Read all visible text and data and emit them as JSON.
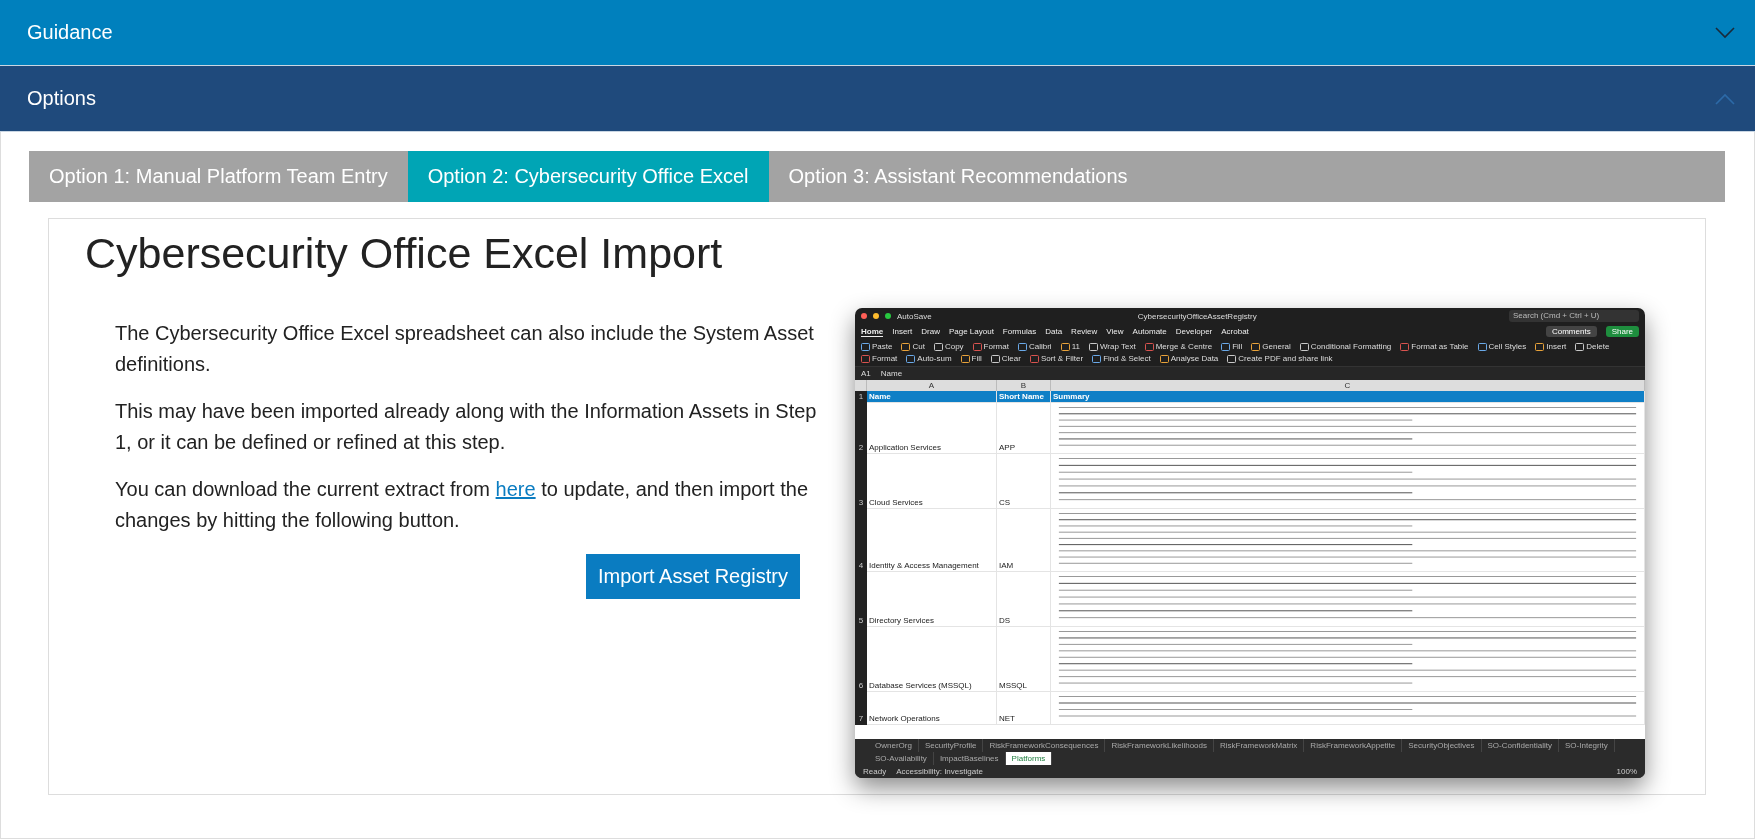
{
  "sections": [
    {
      "title": "Guidance",
      "expanded": false
    },
    {
      "title": "Options",
      "expanded": true
    }
  ],
  "tabs": [
    {
      "label": "Option 1: Manual Platform Team Entry",
      "selected": false
    },
    {
      "label": "Option 2: Cybersecurity Office Excel",
      "selected": true
    },
    {
      "label": "Option 3: Assistant Recommendations",
      "selected": false
    }
  ],
  "content": {
    "heading": "Cybersecurity Office Excel Import",
    "paragraphs": [
      {
        "text": "The Cybersecurity Office Excel spreadsheet can also include the System Asset definitions."
      },
      {
        "text": "This may have been imported already along with the Information Assets in Step 1, or it can be defined or refined at this step."
      },
      {
        "text": "You can download the current extract from ",
        "link": "here",
        "after": " to update, and then import the changes by hitting the following button."
      }
    ],
    "button": "Import Asset Registry"
  },
  "excel": {
    "autosave": "AutoSave",
    "title": "CybersecurityOfficeAssetRegistry",
    "search": {
      "placeholder": "Search (Cmd + Ctrl + U)"
    },
    "ribbon_tabs": [
      {
        "label": "Home",
        "selected": true
      },
      {
        "label": "Insert",
        "selected": false
      },
      {
        "label": "Draw",
        "selected": false
      },
      {
        "label": "Page Layout",
        "selected": false
      },
      {
        "label": "Formulas",
        "selected": false
      },
      {
        "label": "Data",
        "selected": false
      },
      {
        "label": "Review",
        "selected": false
      },
      {
        "label": "View",
        "selected": false
      },
      {
        "label": "Automate",
        "selected": false
      },
      {
        "label": "Developer",
        "selected": false
      },
      {
        "label": "Acrobat",
        "selected": false
      }
    ],
    "comments": "Comments",
    "share": "Share",
    "ribbon_buttons": [
      "Paste",
      "Cut",
      "Copy",
      "Format",
      "Calibri",
      "11",
      "Wrap Text",
      "Merge & Centre",
      "Fill",
      "General",
      "Conditional Formatting",
      "Format as Table",
      "Cell Styles",
      "Insert",
      "Delete",
      "Format",
      "Auto-sum",
      "Fill",
      "Clear",
      "Sort & Filter",
      "Find & Select",
      "Analyse Data",
      "Create PDF and share link"
    ],
    "name_box": "A1",
    "formula": "Name",
    "columns": [
      "A",
      "B",
      "C"
    ],
    "header": {
      "number": "1",
      "cells": [
        "Name",
        "Short Name",
        "Summary"
      ]
    },
    "rows": [
      {
        "number": "2",
        "name": "Application Services",
        "short": "APP"
      },
      {
        "number": "3",
        "name": "Cloud Services",
        "short": "CS"
      },
      {
        "number": "4",
        "name": "Identity & Access Management",
        "short": "IAM"
      },
      {
        "number": "5",
        "name": "Directory Services",
        "short": "DS"
      },
      {
        "number": "6",
        "name": "Database Services (MSSQL)",
        "short": "MSSQL"
      },
      {
        "number": "7",
        "name": "Network Operations",
        "short": "NET"
      }
    ],
    "sheets": [
      {
        "label": "OwnerOrg",
        "selected": false
      },
      {
        "label": "SecurityProfile",
        "selected": false
      },
      {
        "label": "RiskFrameworkConsequences",
        "selected": false
      },
      {
        "label": "RiskFrameworkLikelihoods",
        "selected": false
      },
      {
        "label": "RiskFrameworkMatrix",
        "selected": false
      },
      {
        "label": "RiskFrameworkAppetite",
        "selected": false
      },
      {
        "label": "SecurityObjectives",
        "selected": false
      },
      {
        "label": "SO-Confidentiality",
        "selected": false
      },
      {
        "label": "SO-Integrity",
        "selected": false
      },
      {
        "label": "SO-Availability",
        "selected": false
      },
      {
        "label": "ImpactBaselines",
        "selected": false
      },
      {
        "label": "Platforms",
        "selected": true
      }
    ],
    "status": {
      "ready": "Ready",
      "accessibility": "Accessibility: Investigate",
      "zoom": "100%"
    }
  }
}
